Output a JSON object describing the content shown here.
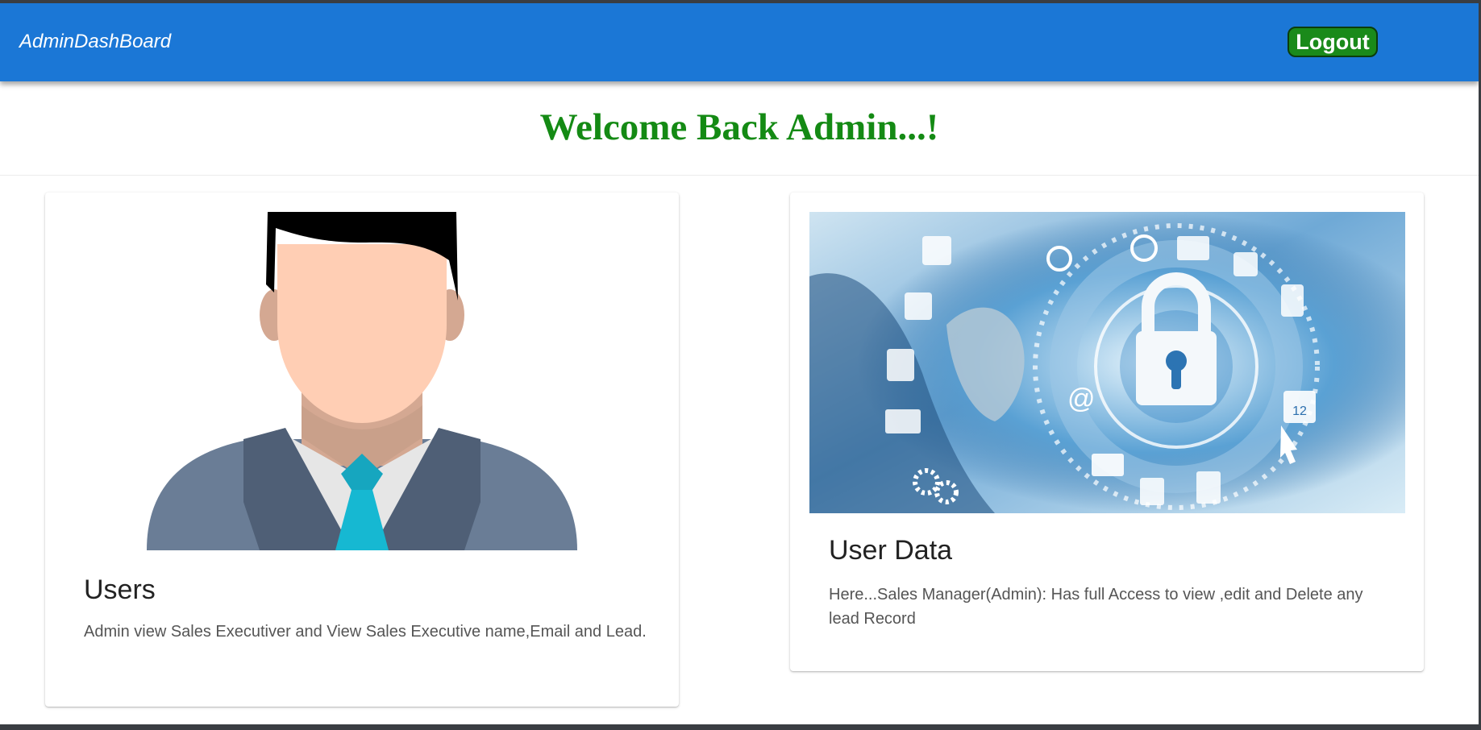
{
  "header": {
    "brand": "AdminDashBoard",
    "logout_label": "Logout",
    "color": "#1b77d6"
  },
  "welcome": {
    "title": "Welcome Back Admin...!",
    "color": "#148a14"
  },
  "cards": [
    {
      "title": "Users",
      "description": "Admin view Sales Executiver and View Sales Executive name,Email and Lead.",
      "image": "admin-avatar-illustration"
    },
    {
      "title": "User Data",
      "description": "Here...Sales Manager(Admin): Has full Access to view ,edit and Delete any lead Record",
      "image": "security-lock-illustration"
    }
  ],
  "illustration": {
    "calendar_text": "12"
  }
}
